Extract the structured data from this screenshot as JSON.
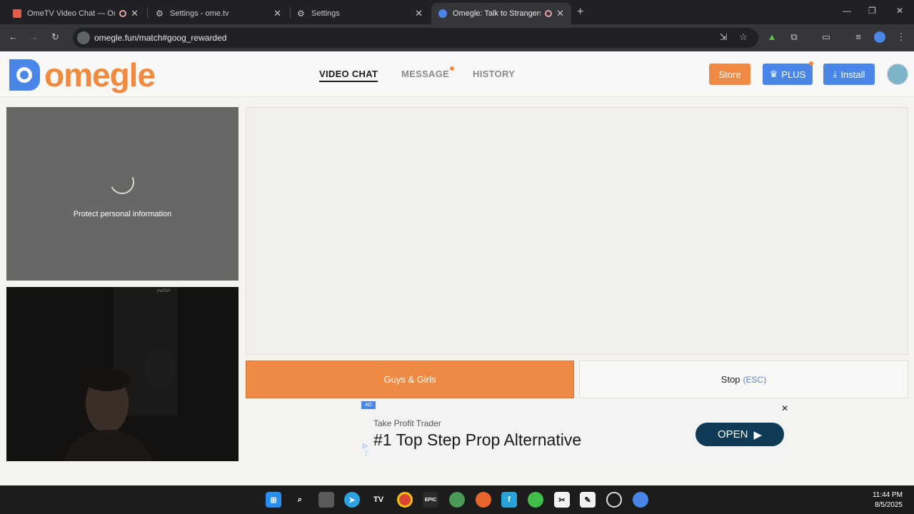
{
  "browser": {
    "tabs": [
      {
        "title": "OmeTV Video Chat — Ome",
        "favicon": "ometv-favicon-icon",
        "recording": true
      },
      {
        "title": "Settings - ome.tv",
        "favicon": "gear-icon",
        "recording": false
      },
      {
        "title": "Settings",
        "favicon": "gear-icon",
        "recording": false
      },
      {
        "title": "Omegle: Talk to Strangers v",
        "favicon": "omegle-favicon-icon",
        "recording": true,
        "active": true
      }
    ],
    "new_tab": "+",
    "url": "omegle.fun/match#goog_rewarded"
  },
  "header": {
    "logo_text": "omegle",
    "nav": [
      {
        "label": "VIDEO CHAT",
        "active": true
      },
      {
        "label": "MESSAGE",
        "badge_dot": true
      },
      {
        "label": "HISTORY"
      }
    ],
    "store_label": "Store",
    "plus_label": "PLUS",
    "install_label": "Install"
  },
  "self_panel": {
    "status": "Protect personal information"
  },
  "camera": {
    "watermark": "mcDVI"
  },
  "actions": {
    "start_label": "Guys & Girls",
    "stop_label": "Stop",
    "stop_hint": "(ESC)"
  },
  "ad": {
    "badge": "AD",
    "advertiser": "Take Profit Trader",
    "headline": "#1 Top Step Prop Alternative",
    "cta": "OPEN",
    "close": "✕"
  },
  "taskbar": {
    "time": "11:44 PM",
    "date": "8/5/2025"
  },
  "colors": {
    "accent_orange": "#ef8a45",
    "plus_blue": "#4a86e8",
    "ad_cta": "#0f3a57"
  }
}
